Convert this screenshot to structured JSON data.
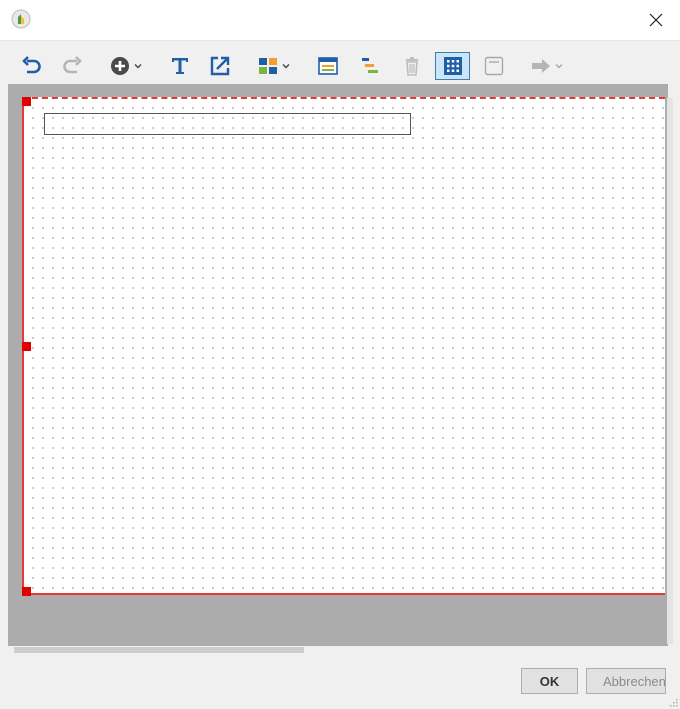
{
  "window": {
    "title": "",
    "icon": "app-leaf-icon",
    "close_icon": "close-icon"
  },
  "toolbar": {
    "items": [
      {
        "name": "undo",
        "icon": "undo-icon",
        "enabled": true
      },
      {
        "name": "redo",
        "icon": "redo-icon",
        "enabled": false
      },
      {
        "name": "add",
        "icon": "add-circle-icon",
        "dropdown": true,
        "enabled": true
      },
      {
        "name": "text",
        "icon": "text-icon",
        "enabled": true
      },
      {
        "name": "export",
        "icon": "external-link-icon",
        "enabled": true
      },
      {
        "name": "layout",
        "icon": "layout-blocks-icon",
        "dropdown": true,
        "enabled": true
      },
      {
        "name": "form",
        "icon": "form-window-icon",
        "enabled": true
      },
      {
        "name": "align",
        "icon": "align-bars-icon",
        "enabled": true
      },
      {
        "name": "delete",
        "icon": "trash-icon",
        "enabled": false
      },
      {
        "name": "grid",
        "icon": "grid-icon",
        "enabled": true,
        "active": true
      },
      {
        "name": "frame",
        "icon": "frame-icon",
        "enabled": false
      },
      {
        "name": "arrow",
        "icon": "arrow-right-icon",
        "dropdown": true,
        "enabled": false
      }
    ]
  },
  "canvas": {
    "background": "#ffffff",
    "selection_color": "#e53935",
    "workspace_color": "#acacac"
  },
  "buttons": {
    "ok_label": "OK",
    "cancel_label": "Abbrechen"
  }
}
